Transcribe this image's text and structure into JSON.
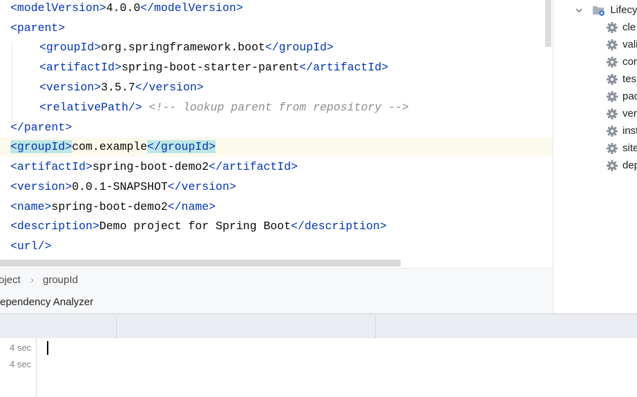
{
  "editor": {
    "lines": [
      {
        "indent": 0,
        "open_tag": "<modelVersion>",
        "text": "4.0.0",
        "close_tag": "</modelVersion>"
      },
      {
        "indent": 0,
        "open_tag": "<parent>",
        "text": "",
        "close_tag": ""
      },
      {
        "indent": 1,
        "open_tag": "<groupId>",
        "text": "org.springframework.boot",
        "close_tag": "</groupId>"
      },
      {
        "indent": 1,
        "open_tag": "<artifactId>",
        "text": "spring-boot-starter-parent",
        "close_tag": "</artifactId>"
      },
      {
        "indent": 1,
        "open_tag": "<version>",
        "text": "3.5.7",
        "close_tag": "</version>"
      },
      {
        "indent": 1,
        "open_tag": "<relativePath/>",
        "text": " ",
        "close_tag": "",
        "comment": "<!-- lookup parent from repository -->"
      },
      {
        "indent": 0,
        "open_tag": "</parent>",
        "text": "",
        "close_tag": ""
      },
      {
        "indent": 0,
        "open_tag": "<groupId>",
        "text": "com.example",
        "close_tag": "</groupId>",
        "highlight_tags": true,
        "caret_line": true
      },
      {
        "indent": 0,
        "open_tag": "<artifactId>",
        "text": "spring-boot-demo2",
        "close_tag": "</artifactId>"
      },
      {
        "indent": 0,
        "open_tag": "<version>",
        "text": "0.0.1-SNAPSHOT",
        "close_tag": "</version>"
      },
      {
        "indent": 0,
        "open_tag": "<name>",
        "text": "spring-boot-demo2",
        "close_tag": "</name>"
      },
      {
        "indent": 0,
        "open_tag": "<description>",
        "text": "Demo project for Spring Boot",
        "close_tag": "</description>"
      },
      {
        "indent": 0,
        "open_tag": "<url/>",
        "text": "",
        "close_tag": ""
      }
    ]
  },
  "breadcrumb": {
    "items": [
      "oject",
      "groupId"
    ],
    "separator": "›"
  },
  "bottom_tab": {
    "label": "ependency Analyzer"
  },
  "maven": {
    "root": {
      "label": "Lifecyc"
    },
    "items": [
      "cle",
      "vali",
      "cor",
      "tes",
      "pac",
      "ver",
      "inst",
      "site",
      "dep"
    ]
  },
  "run": {
    "times": [
      "4 sec",
      "4 sec"
    ]
  },
  "colors": {
    "tag": "#0033b3",
    "text": "#080808",
    "comment": "#8c8c8c",
    "tag_highlight": "#bee6e7",
    "caret_line": "#fcfaed",
    "gear": "#8a8f99"
  }
}
